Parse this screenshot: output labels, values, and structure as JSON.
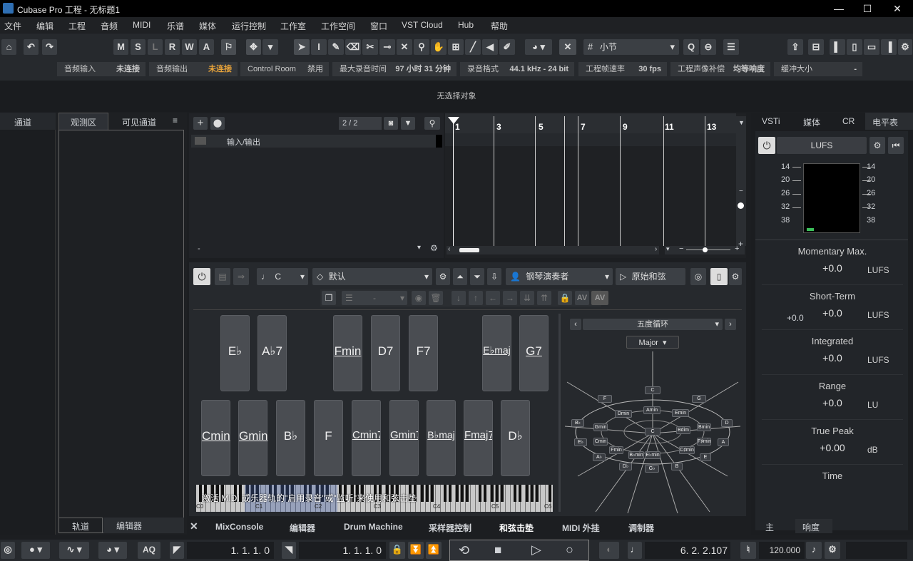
{
  "app": {
    "title": "Cubase Pro 工程 - 无标题1"
  },
  "menu": [
    "文件",
    "编辑",
    "工程",
    "音频",
    "MIDI",
    "乐谱",
    "媒体",
    "运行控制",
    "工作室",
    "工作空间",
    "窗口",
    "VST Cloud",
    "Hub",
    "帮助"
  ],
  "toolbar": {
    "msl": [
      "M",
      "S",
      "L",
      "R",
      "W",
      "A"
    ],
    "quantize": "小节"
  },
  "status": [
    {
      "k": "音频输入",
      "v": "未连接"
    },
    {
      "k": "音频输出",
      "v": "未连接"
    },
    {
      "k": "Control Room",
      "v": "禁用"
    },
    {
      "k": "最大录音时间",
      "v": "97 小时 31 分钟"
    },
    {
      "k": "录音格式",
      "v": "44.1 kHz - 24 bit"
    },
    {
      "k": "工程帧速率",
      "v": "30 fps"
    },
    {
      "k": "工程声像补偿",
      "v": "均等响度"
    },
    {
      "k": "缓冲大小",
      "v": "-"
    }
  ],
  "info": "无选择对象",
  "left": {
    "tab1": "通道",
    "tab2": "观测区",
    "tab3": "可见通道",
    "bottom1": "轨道",
    "bottom2": "编辑器"
  },
  "tracks": {
    "count": "2 / 2",
    "folder": "输入/输出",
    "dash": "-"
  },
  "ruler": [
    "1",
    "3",
    "5",
    "7",
    "9",
    "11",
    "13"
  ],
  "chordpads": {
    "key": "C",
    "preset": "默认",
    "player": "钢琴演奏者",
    "voicing": "原始和弦",
    "dash": "-",
    "top": [
      "E♭",
      "A♭7",
      "Fmin",
      "D7",
      "F7",
      "E♭maj",
      "G7"
    ],
    "bottom": [
      "Cmin",
      "Gmin",
      "B♭",
      "F",
      "Cmin7",
      "Gmin7",
      "B♭maj",
      "Fmaj7",
      "D♭"
    ],
    "circle_title": "五度循环",
    "scale": "Major",
    "message": "激活 MIDI 或乐器轨的\"启用录音\"或\"监听\"来使用和弦击垫",
    "piano_labels": [
      "C0",
      "C1",
      "C2",
      "C3",
      "C4",
      "C5",
      "C6"
    ],
    "circle_nodes": [
      "C",
      "F",
      "G",
      "Dmin",
      "Amin",
      "Emin",
      "C",
      "B♭",
      "Gmin",
      "Bdim",
      "D",
      "Bmin",
      "E♭",
      "Cmin",
      "F♯min",
      "A",
      "A♭",
      "Fmin",
      "B♭min",
      "E♭min",
      "C♯min",
      "E",
      "D♭",
      "G♭",
      "B"
    ]
  },
  "right": {
    "tabs": [
      "VSTi",
      "媒体",
      "CR",
      "电平表"
    ],
    "lufs": "LUFS",
    "scale": [
      "14",
      "20",
      "26",
      "32",
      "38"
    ],
    "rows": [
      {
        "t": "Momentary Max.",
        "v": "+0.0",
        "u": "LUFS",
        "extra": ""
      },
      {
        "t": "Short-Term",
        "v": "+0.0",
        "u": "LUFS",
        "extra": "+0.0"
      },
      {
        "t": "Integrated",
        "v": "+0.0",
        "u": "LUFS",
        "extra": ""
      },
      {
        "t": "Range",
        "v": "+0.0",
        "u": "LU",
        "extra": ""
      },
      {
        "t": "True Peak",
        "v": "+0.00",
        "u": "dB",
        "extra": ""
      },
      {
        "t": "Time",
        "v": "",
        "u": "",
        "extra": ""
      }
    ],
    "bottom1": "主",
    "bottom2": "响度"
  },
  "bottomtabs": [
    "MixConsole",
    "编辑器",
    "Drum Machine",
    "采样器控制",
    "和弦击垫",
    "MIDI 外挂",
    "调制器"
  ],
  "transport": {
    "aq": "AQ",
    "left": "1. 1. 1.   0",
    "right": "1. 1. 1.   0",
    "pos": "6. 2. 2.107",
    "tempo": "120.000"
  },
  "colors": {
    "accent": "#3f8ee0",
    "bg": "#1c1e21"
  }
}
